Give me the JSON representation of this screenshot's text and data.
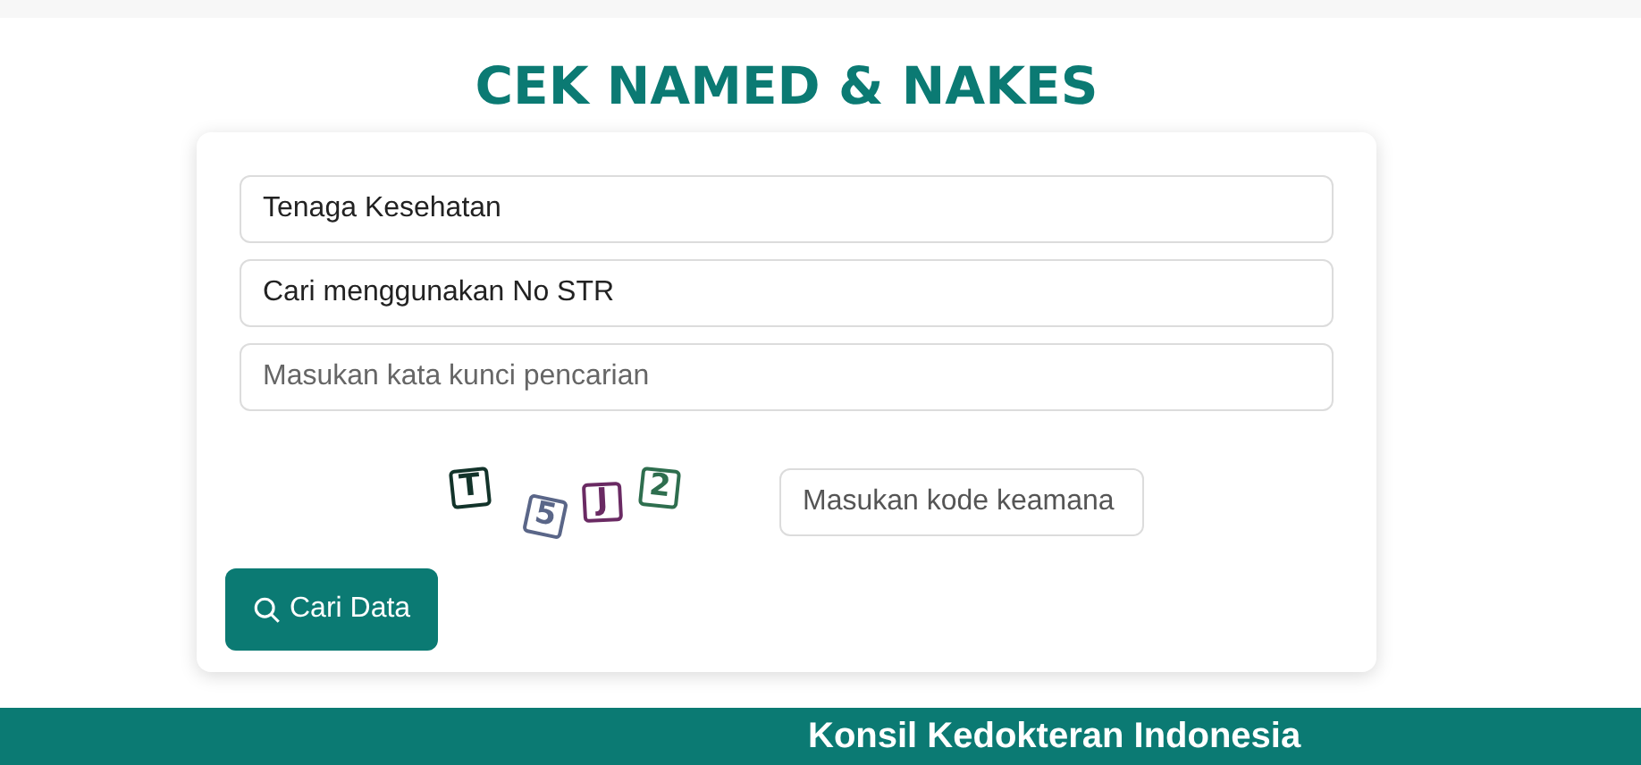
{
  "title": "CEK NAMED & NAKES",
  "fields": [
    {
      "kind": "select",
      "value": "Tenaga Kesehatan"
    },
    {
      "kind": "select",
      "value": "Cari menggunakan No STR"
    },
    {
      "kind": "input",
      "placeholder": "Masukan kata kunci pencarian"
    }
  ],
  "captcha": {
    "characters": [
      {
        "text": "T",
        "color": "#12332a"
      },
      {
        "text": "5",
        "color": "#5a6688"
      },
      {
        "text": "J",
        "color": "#6a2a63"
      },
      {
        "text": "2",
        "color": "#2e6e4e"
      }
    ],
    "placeholder": "Masukan kode keamana"
  },
  "search_button": "Cari Data",
  "footer": "Konsil Kedokteran Indonesia"
}
